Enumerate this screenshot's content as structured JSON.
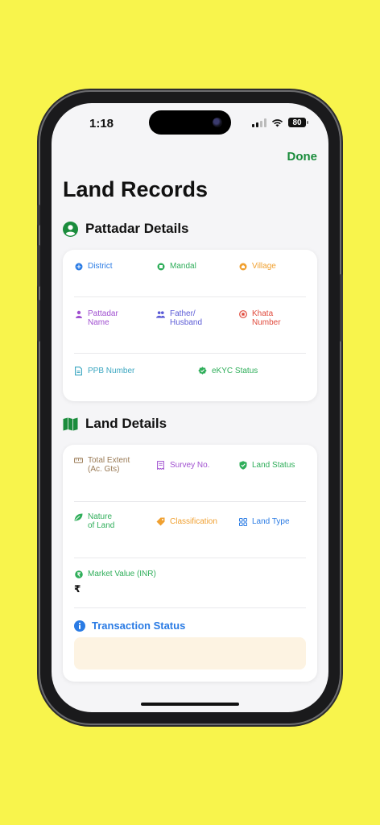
{
  "status_bar": {
    "time": "1:18",
    "battery": "80"
  },
  "nav": {
    "done_label": "Done"
  },
  "page_title": "Land Records",
  "pattadar": {
    "heading": "Pattadar Details",
    "fields": {
      "district": "District",
      "mandal": "Mandal",
      "village": "Village",
      "pattadar_name": "Pattadar Name",
      "father_husband": "Father/ Husband",
      "khata_number": "Khata Number",
      "ppb_number": "PPB Number",
      "ekyc_status": "eKYC Status"
    }
  },
  "land": {
    "heading": "Land Details",
    "fields": {
      "total_extent": "Total Extent (Ac. Gts)",
      "survey_no": "Survey No.",
      "land_status": "Land Status",
      "nature_of_land": "Nature of Land",
      "classification": "Classification",
      "land_type": "Land Type",
      "market_value": "Market Value (INR)",
      "market_value_amount": "₹"
    },
    "transaction_heading": "Transaction Status"
  },
  "colors": {
    "background": "#f8f44c",
    "accent_green": "#1a8c3c",
    "blue": "#2a7be4",
    "orange": "#f0a030",
    "purple": "#a050d0",
    "red": "#e04a3c",
    "teal": "#3aa6c0",
    "brown": "#9a7a55"
  }
}
